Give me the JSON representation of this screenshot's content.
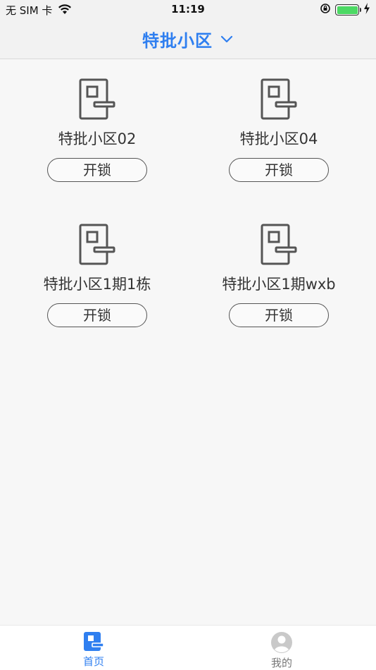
{
  "status_bar": {
    "carrier": "无 SIM 卡",
    "time": "11:19",
    "battery_level": 1.0,
    "icons": [
      "wifi-icon",
      "orientation-lock-icon",
      "battery-icon",
      "charging-bolt-icon"
    ]
  },
  "nav": {
    "title": "特批小区",
    "dropdown_icon": "chevron-down-icon",
    "accent_color": "#2f7ff0"
  },
  "doors": [
    {
      "name": "特批小区02",
      "button": "开锁",
      "icon": "door-lock-icon"
    },
    {
      "name": "特批小区04",
      "button": "开锁",
      "icon": "door-lock-icon"
    },
    {
      "name": "特批小区1期1栋",
      "button": "开锁",
      "icon": "door-lock-icon"
    },
    {
      "name": "特批小区1期wxb",
      "button": "开锁",
      "icon": "door-lock-icon"
    }
  ],
  "tabs": [
    {
      "label": "首页",
      "icon": "home-door-icon",
      "active": true
    },
    {
      "label": "我的",
      "icon": "profile-icon",
      "active": false
    }
  ]
}
